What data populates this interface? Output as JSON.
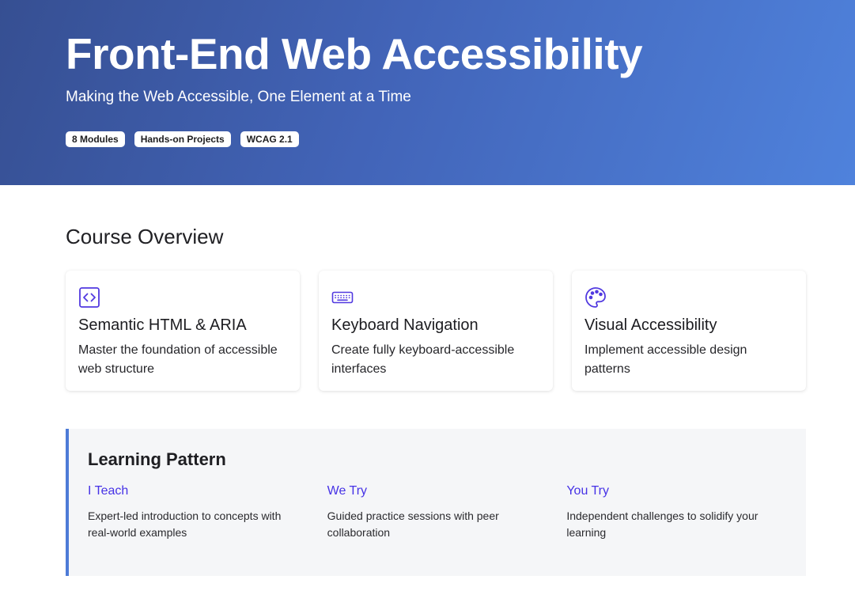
{
  "hero": {
    "title": "Front-End Web Accessibility",
    "subtitle": "Making the Web Accessible, One Element at a Time",
    "badges": [
      "8 Modules",
      "Hands-on Projects",
      "WCAG 2.1"
    ]
  },
  "overview": {
    "title": "Course Overview",
    "cards": [
      {
        "icon": "code-icon",
        "title": "Semantic HTML & ARIA",
        "description": "Master the foundation of accessible web structure"
      },
      {
        "icon": "keyboard-icon",
        "title": "Keyboard Navigation",
        "description": "Create fully keyboard-accessible interfaces"
      },
      {
        "icon": "palette-icon",
        "title": "Visual Accessibility",
        "description": "Implement accessible design patterns"
      }
    ]
  },
  "learning_pattern": {
    "title": "Learning Pattern",
    "steps": [
      {
        "title": "I Teach",
        "description": "Expert-led introduction to concepts with real-world examples"
      },
      {
        "title": "We Try",
        "description": "Guided practice sessions with peer collaboration"
      },
      {
        "title": "You Try",
        "description": "Independent challenges to solidify your learning"
      }
    ]
  },
  "colors": {
    "hero_gradient_start": "#364f92",
    "hero_gradient_end": "#4f82dc",
    "accent": "#4632e6",
    "pattern_border": "#4d7bd7",
    "pattern_background": "#f5f6f8"
  }
}
